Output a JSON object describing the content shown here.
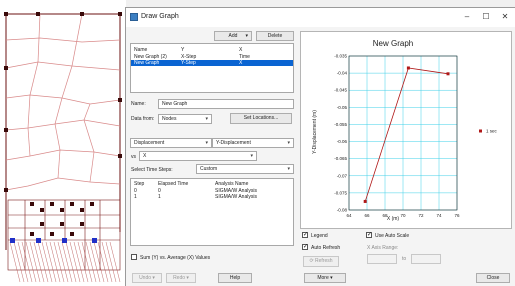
{
  "window": {
    "title": "Draw Graph",
    "minimize": "–",
    "maximize": "☐",
    "close": "✕"
  },
  "toolbar": {
    "add_label": "Add",
    "add_arrow": "▾",
    "delete_label": "Delete"
  },
  "graph_list": {
    "headers": [
      "Name",
      "Y",
      "X"
    ],
    "rows": [
      [
        "New Graph (2)",
        "X-Step",
        "Time"
      ],
      [
        "New Graph",
        "Y-Step",
        "X"
      ]
    ],
    "selected_index": 1
  },
  "form": {
    "name_label": "Name:",
    "name_value": "New Graph",
    "data_from_label": "Data from:",
    "data_from_value": "Nodes",
    "set_locations_label": "Set Locations...",
    "x_variable": "Displacement",
    "y_variable": "Y-Displacement",
    "vs_label": "vs",
    "vs_value": "X",
    "time_steps_label": "Select Time Steps:",
    "time_steps_value": "Custom"
  },
  "steps_table": {
    "headers": [
      "Step",
      "Elapsed Time",
      "Analysis Name"
    ],
    "rows": [
      [
        "0",
        "0",
        "SIGMA/W Analysis"
      ],
      [
        "1",
        "1",
        "SIGMA/W Analysis"
      ]
    ]
  },
  "sum_checkbox_label": "Sum (Y) vs. Average (X) Values",
  "bottom_buttons": {
    "undo": "Undo",
    "redo": "Redo",
    "help": "Help",
    "more": "More",
    "close": "Close"
  },
  "options": {
    "legend_label": "Legend",
    "legend_checked": true,
    "auto_refresh_label": "Auto Refresh",
    "auto_refresh_checked": true,
    "refresh_label": "Refresh",
    "use_auto_scale_label": "Use Auto Scale",
    "use_auto_scale_checked": true,
    "x_axis_range_label": "X Axis Range:",
    "to_label": "to"
  },
  "colors": {
    "series": "#b01818",
    "accent": "#0a64d2",
    "grid": "#3fd0e8"
  },
  "chart_data": {
    "type": "line",
    "title": "New Graph",
    "xlabel": "X (m)",
    "ylabel": "Y-Displacement (m)",
    "xlim": [
      64,
      76
    ],
    "ylim": [
      -0.08,
      -0.035
    ],
    "xticks": [
      "64",
      "66",
      "68",
      "70",
      "72",
      "74",
      "76"
    ],
    "yticks": [
      "-0.035",
      "-0.04",
      "-0.045",
      "-0.05",
      "-0.055",
      "-0.06",
      "-0.065",
      "-0.07",
      "-0.075",
      "-0.08"
    ],
    "grid": true,
    "legend_position": "right",
    "series": [
      {
        "name": "1 sec",
        "x": [
          65.8,
          70.6,
          75.0
        ],
        "y": [
          -0.0775,
          -0.0385,
          -0.0402
        ]
      }
    ]
  }
}
